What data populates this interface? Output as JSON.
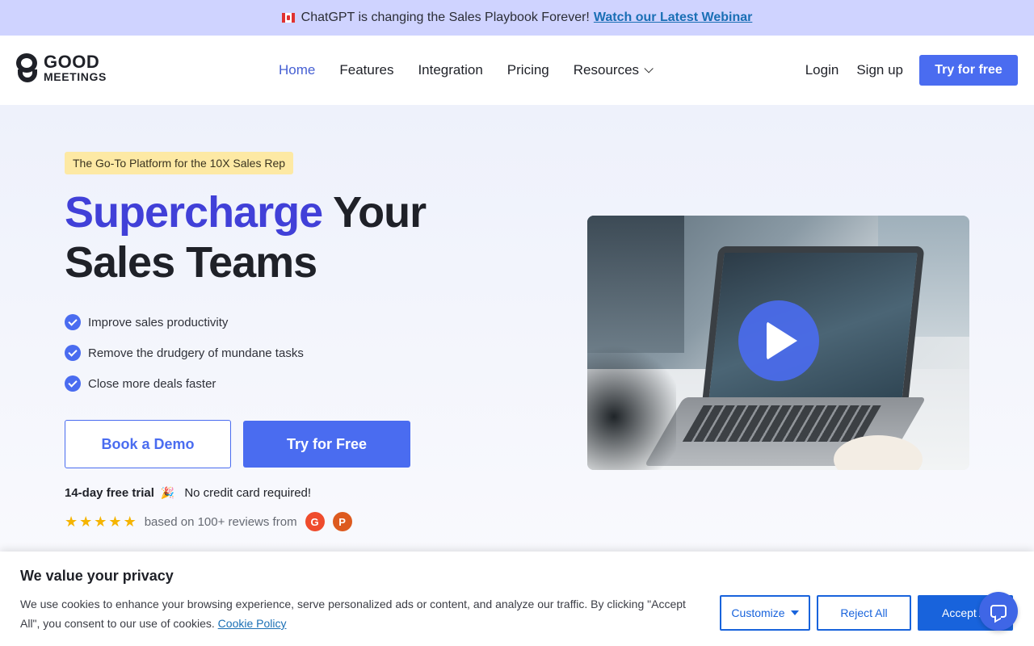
{
  "announcement": {
    "text": "ChatGPT is changing the Sales Playbook Forever!",
    "link_label": "Watch our Latest Webinar"
  },
  "header": {
    "logo": {
      "line1": "GOOD",
      "line2": "MEETINGS"
    },
    "nav": [
      {
        "label": "Home",
        "active": true
      },
      {
        "label": "Features"
      },
      {
        "label": "Integration"
      },
      {
        "label": "Pricing"
      },
      {
        "label": "Resources",
        "has_dropdown": true
      }
    ],
    "login_label": "Login",
    "signup_label": "Sign up",
    "try_label": "Try for free"
  },
  "hero": {
    "tag": "The Go-To Platform for the 10X Sales Rep",
    "headline_accent": "Supercharge",
    "headline_rest1": " Your",
    "headline_line2": "Sales Teams",
    "bullets": [
      "Improve sales productivity",
      "Remove the drudgery of mundane tasks",
      "Close more deals faster"
    ],
    "book_demo_label": "Book a Demo",
    "try_free_label": "Try for Free",
    "trial_bold": "14-day free trial",
    "trial_emoji": "🎉",
    "trial_rest": "No credit card required!",
    "rating_stars": 5,
    "reviews_text": "based on 100+ reviews from",
    "review_sites": [
      {
        "icon": "g2-icon",
        "glyph": "G"
      },
      {
        "icon": "product-hunt-icon",
        "glyph": "P"
      }
    ]
  },
  "cookie_banner": {
    "title": "We value your privacy",
    "text": "We use cookies to enhance your browsing experience, serve personalized ads or content, and analyze our traffic. By clicking \"Accept All\", you consent to our use of cookies.",
    "policy_link": "Cookie Policy",
    "customize_label": "Customize",
    "reject_label": "Reject All",
    "accept_label": "Accept All"
  },
  "colors": {
    "brand": "#4a6cf0",
    "headline_accent": "#4140d8",
    "announce_bg": "#cfd3ff",
    "tag_bg": "#fde9a4",
    "cookie_blue": "#1863dc"
  }
}
